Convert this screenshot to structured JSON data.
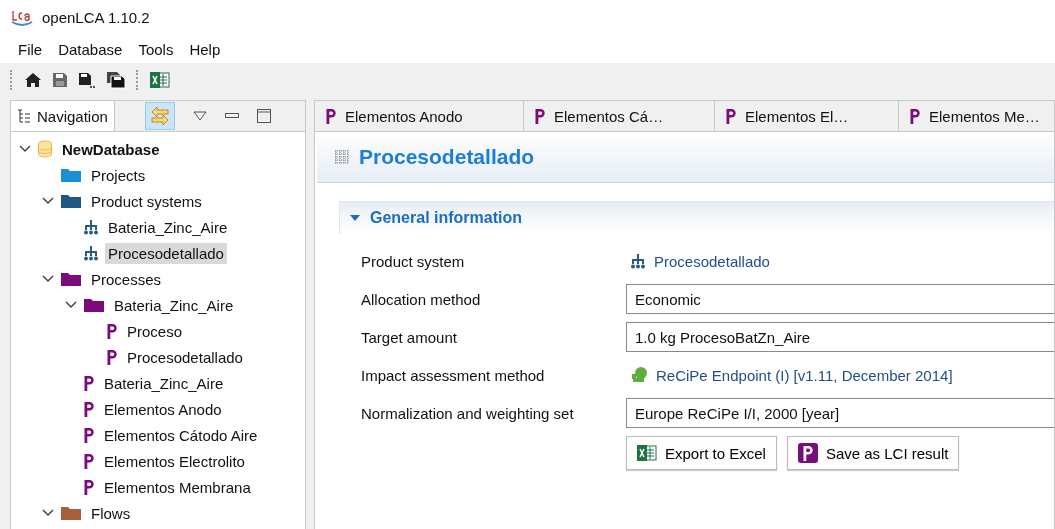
{
  "window": {
    "title": "openLCA 1.10.2"
  },
  "menu": [
    "File",
    "Database",
    "Tools",
    "Help"
  ],
  "navigation": {
    "tab": "Navigation",
    "tree": [
      {
        "label": "NewDatabase",
        "kind": "database",
        "expanded": true,
        "selected": false,
        "children": [
          {
            "label": "Projects",
            "kind": "folder",
            "color": "#1a8fd6",
            "selected": false
          },
          {
            "label": "Product systems",
            "kind": "folder",
            "color": "#1d5a80",
            "expanded": true,
            "selected": false,
            "children": [
              {
                "label": "Bateria_Zinc_Aire",
                "kind": "system",
                "selected": false
              },
              {
                "label": "Procesodetallado",
                "kind": "system",
                "selected": true
              }
            ]
          },
          {
            "label": "Processes",
            "kind": "folder",
            "color": "#7b0a7b",
            "expanded": true,
            "selected": false,
            "children": [
              {
                "label": "Bateria_Zinc_Aire",
                "kind": "folder",
                "color": "#7b0a7b",
                "expanded": true,
                "selected": false,
                "children": [
                  {
                    "label": "Proceso",
                    "kind": "process",
                    "selected": false
                  },
                  {
                    "label": "Procesodetallado",
                    "kind": "process",
                    "selected": false
                  }
                ]
              },
              {
                "label": "Bateria_Zinc_Aire",
                "kind": "process",
                "selected": false
              },
              {
                "label": "Elementos Anodo",
                "kind": "process",
                "selected": false
              },
              {
                "label": "Elementos Cátodo Aire",
                "kind": "process",
                "selected": false
              },
              {
                "label": "Elementos Electrolito",
                "kind": "process",
                "selected": false
              },
              {
                "label": "Elementos Membrana",
                "kind": "process",
                "selected": false
              }
            ]
          },
          {
            "label": "Flows",
            "kind": "folder",
            "color": "#a85f3c",
            "expanded": true,
            "selected": false
          }
        ]
      }
    ]
  },
  "editor_tabs": [
    "Elementos Anodo",
    "Elementos Cá…",
    "Elementos El…",
    "Elementos Me…"
  ],
  "editor": {
    "title": "Procesodetallado",
    "section": {
      "title": "General information",
      "expanded": true,
      "rows": [
        {
          "label": "Product system",
          "kind": "system_link",
          "value": "Procesodetallado"
        },
        {
          "label": "Allocation method",
          "kind": "field",
          "value": "Economic"
        },
        {
          "label": "Target amount",
          "kind": "field",
          "value": "1.0 kg ProcesoBatZn_Aire"
        },
        {
          "label": "Impact assessment method",
          "kind": "method_link",
          "value": "ReCiPe Endpoint (I) [v1.11,  December 2014]"
        },
        {
          "label": "Normalization and weighting set",
          "kind": "field",
          "value": "Europe ReCiPe I/I, 2000 [year]"
        }
      ],
      "buttons": [
        "Export to Excel",
        "Save as LCI result"
      ]
    }
  }
}
